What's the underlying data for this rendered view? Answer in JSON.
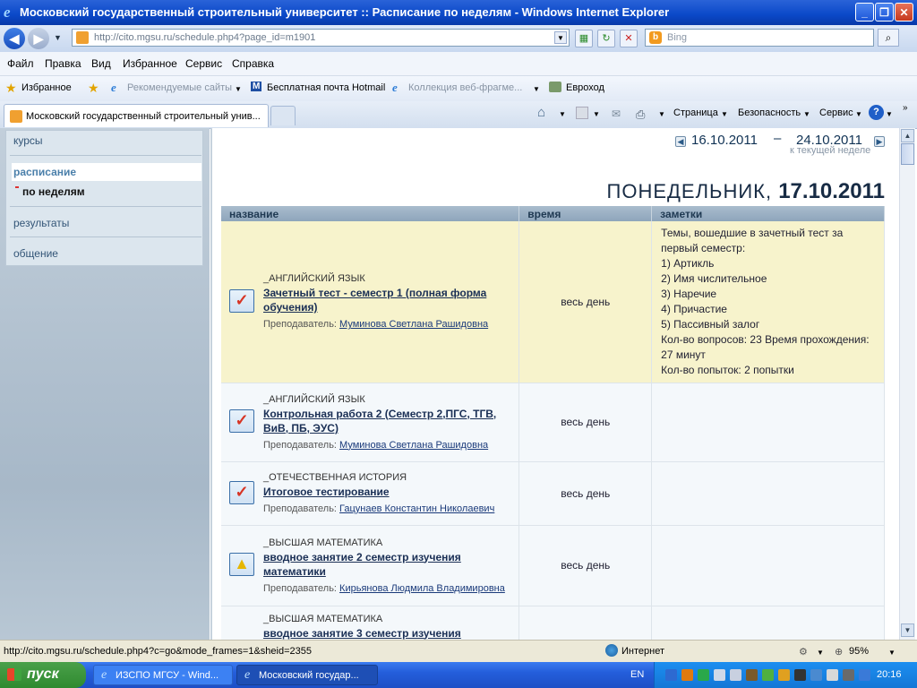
{
  "window": {
    "title": "Московский государственный строительный университет :: Расписание по неделям - Windows Internet Explorer"
  },
  "browser": {
    "address": "http://cito.mgsu.ru/schedule.php4?page_id=m1901",
    "search_placeholder": "Bing",
    "menu": [
      "Файл",
      "Правка",
      "Вид",
      "Избранное",
      "Сервис",
      "Справка"
    ],
    "favorites": {
      "label": "Избранное",
      "items": [
        "Рекомендуемые сайты",
        "Бесплатная почта Hotmail",
        "Коллекция веб-фрагме...",
        "Евроход"
      ]
    },
    "tab_title": "Московский государственный строительный унив...",
    "command_bar": [
      "Страница",
      "Безопасность",
      "Сервис"
    ]
  },
  "sidebar": {
    "items": [
      {
        "label": "курсы"
      },
      {
        "label": "расписание"
      },
      {
        "label": "по неделям"
      },
      {
        "label": "результаты"
      },
      {
        "label": "общение"
      }
    ]
  },
  "schedule": {
    "date_from": "16.10.2011",
    "date_to": "24.10.2011",
    "date_sep": "–",
    "to_current_week": "к текущей неделе",
    "day_name": "ПОНЕДЕЛЬНИК,",
    "day_date": "17.10.2011",
    "columns": [
      "название",
      "время",
      "заметки"
    ],
    "rows": [
      {
        "subject": "_АНГЛИЙСКИЙ ЯЗЫК",
        "title": "Зачетный тест - семестр 1 (полная форма обучения)",
        "teacher_label": "Преподаватель:",
        "teacher": "Муминова Светлана Рашидовна",
        "time": "весь день",
        "notes": [
          "Темы, вошедшие в зачетный тест за первый семестр:",
          "1) Артикль",
          "2) Имя числительное",
          "3) Наречие",
          "4) Причастие",
          "5) Пассивный залог",
          "Кол-во вопросов: 23 Время прохождения: 27 минут",
          "Кол-во попыток: 2 попытки"
        ],
        "icon": "test-icon"
      },
      {
        "subject": "_АНГЛИЙСКИЙ ЯЗЫК",
        "title": "Контрольная работа 2 (Семестр 2,ПГС, ТГВ, ВиВ, ПБ, ЭУС)",
        "teacher_label": "Преподаватель:",
        "teacher": "Муминова Светлана Рашидовна",
        "time": "весь день",
        "notes": [],
        "icon": "test-icon"
      },
      {
        "subject": "_ОТЕЧЕСТВЕННАЯ ИСТОРИЯ",
        "title": "Итоговое тестирование",
        "teacher_label": "Преподаватель:",
        "teacher": "Гацунаев Константин Николаевич",
        "time": "весь день",
        "notes": [],
        "icon": "test-icon"
      },
      {
        "subject": "_ВЫСШАЯ МАТЕМАТИКА",
        "title": "вводное занятие 2 семестр изучения математики",
        "teacher_label": "Преподаватель:",
        "teacher": "Кирьянова Людмила Владимировна",
        "time": "весь день",
        "notes": [],
        "icon": "warning-icon"
      },
      {
        "subject": "_ВЫСШАЯ МАТЕМАТИКА",
        "title": "вводное занятие 3 семестр изучения",
        "teacher_label": "",
        "teacher": "",
        "time": "",
        "notes": [],
        "icon": "warning-icon"
      }
    ]
  },
  "status": {
    "url": "http://cito.mgsu.ru/schedule.php4?c=go&mode_frames=1&sheid=2355",
    "zone": "Интернет",
    "zoom": "95%"
  },
  "taskbar": {
    "start": "пуск",
    "windows": [
      "ИЗСПО МГСУ - Wind...",
      "Московский государ..."
    ],
    "lang": "EN",
    "time": "20:16"
  }
}
